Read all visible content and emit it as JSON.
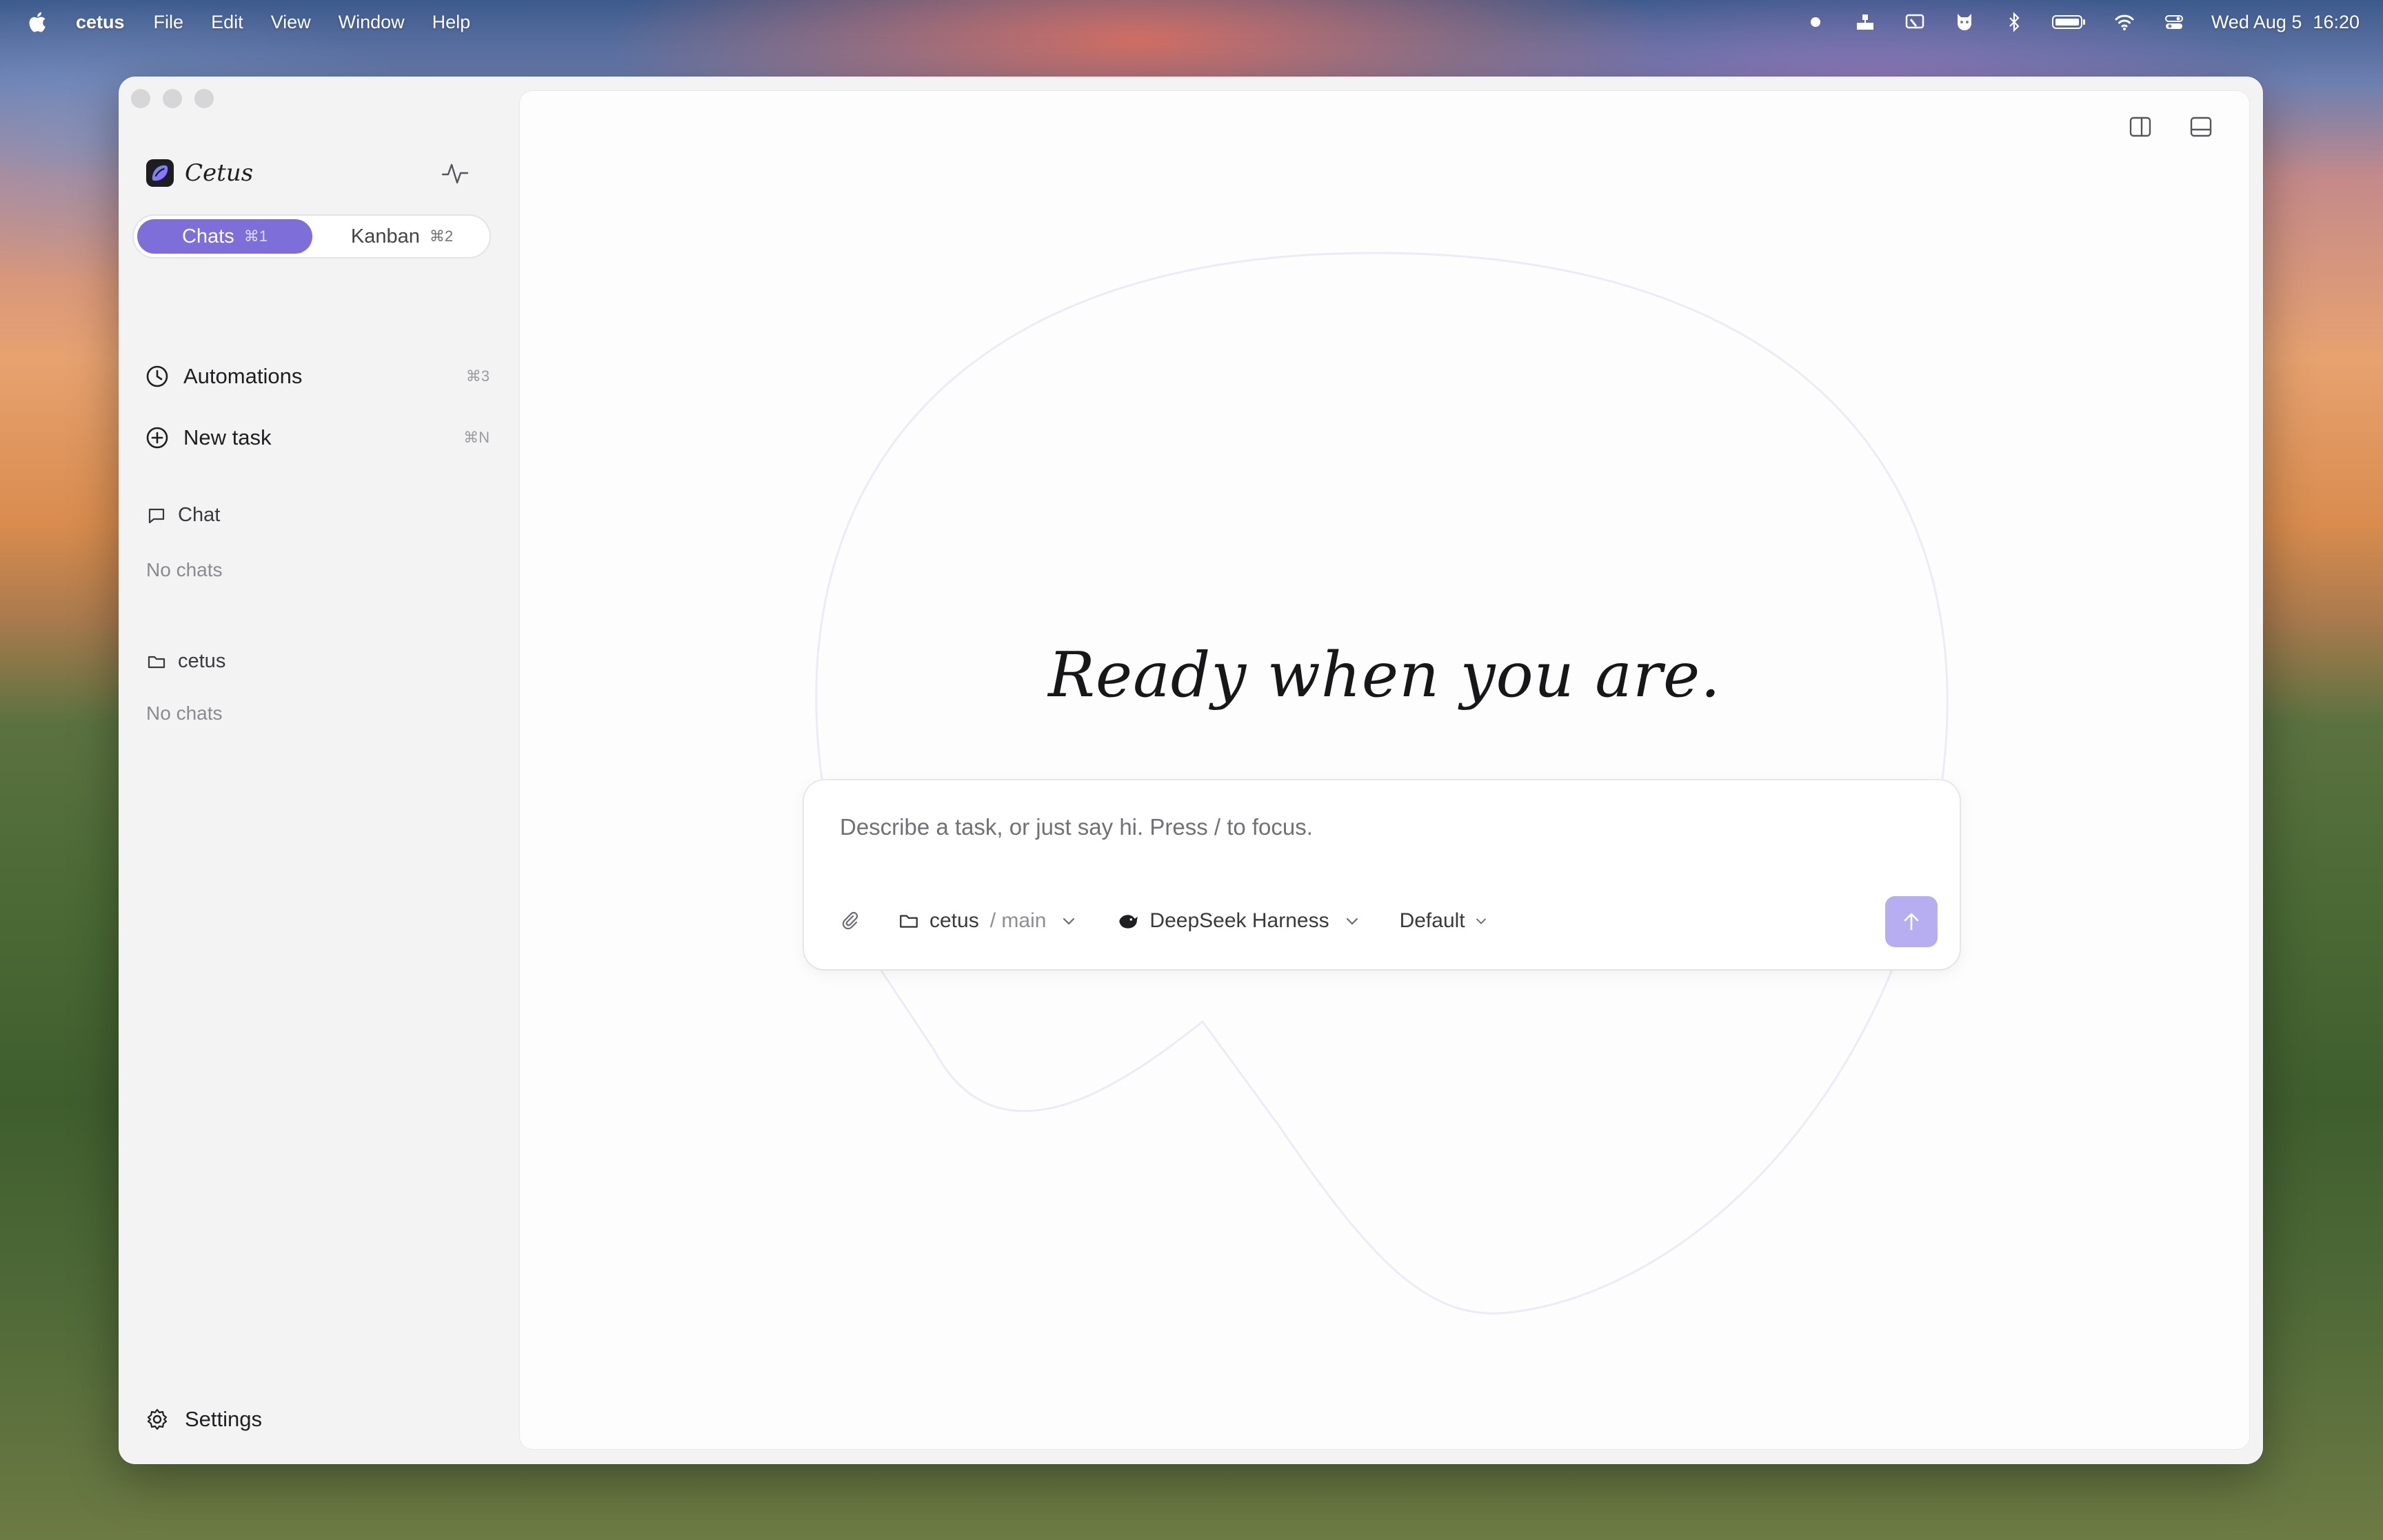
{
  "menubar": {
    "app_name": "cetus",
    "menus": [
      "File",
      "Edit",
      "View",
      "Window",
      "Help"
    ],
    "status_icons": [
      "record-dot-icon",
      "network-tray-icon",
      "cast-icon",
      "cat-shield-icon",
      "bluetooth-icon",
      "battery-icon",
      "wifi-icon",
      "control-center-icon"
    ],
    "date": "Wed Aug 5",
    "time": "16:20"
  },
  "sidebar": {
    "brand": "Cetus",
    "tabs": [
      {
        "label": "Chats",
        "shortcut": "⌘1",
        "active": true
      },
      {
        "label": "Kanban",
        "shortcut": "⌘2",
        "active": false
      }
    ],
    "nav": [
      {
        "label": "Automations",
        "shortcut": "⌘3",
        "icon": "clock-icon"
      },
      {
        "label": "New task",
        "shortcut": "⌘N",
        "icon": "plus-circle-icon"
      }
    ],
    "sections": [
      {
        "title": "Chat",
        "icon": "chat-bubble-icon",
        "empty_text": "No chats"
      },
      {
        "title": "cetus",
        "icon": "folder-icon",
        "empty_text": "No chats"
      }
    ],
    "settings_label": "Settings"
  },
  "main": {
    "hero": "Ready when you are.",
    "composer": {
      "placeholder": "Describe a task, or just say hi. Press / to focus.",
      "project": "cetus",
      "branch": "/ main",
      "harness": "DeepSeek Harness",
      "mode": "Default"
    }
  },
  "colors": {
    "accent": "#7d6ed9",
    "send_button": "#b6aef0"
  }
}
